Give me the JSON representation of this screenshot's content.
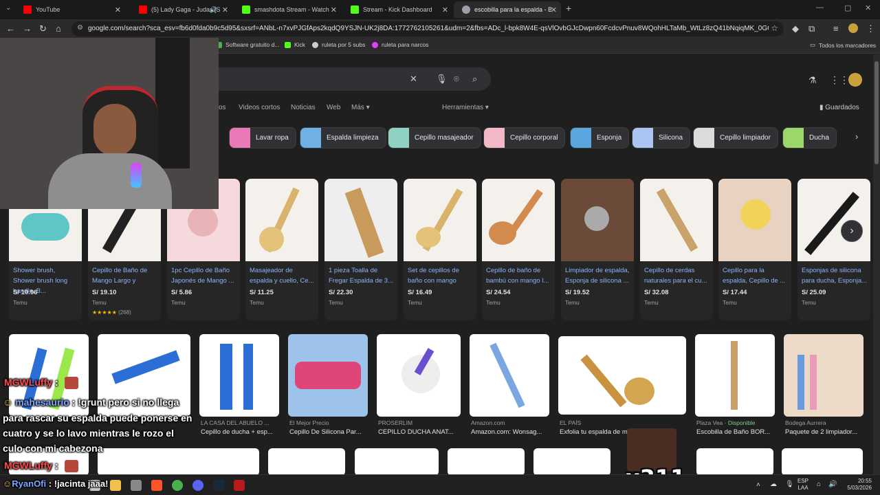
{
  "tabs": [
    {
      "label": "YouTube",
      "color": "#ff0000"
    },
    {
      "label": "(5) Lady Gaga - Judas [Suku",
      "color": "#ff0000"
    },
    {
      "label": "smashdota Stream - Watch Liv",
      "color": "#53fc18"
    },
    {
      "label": "Stream - Kick Dashboard",
      "color": "#53fc18"
    },
    {
      "label": "escobilla para la espalda - Busc",
      "color": "#9aa0a6"
    }
  ],
  "address": {
    "url": "google.com/search?sca_esv=fb6d0fda0b9c5d95&sxsrf=ANbL-n7xvPJGfAps2kqdQ9YSJN-UK2j8DA:1772762105261&udm=2&fbs=ADc_l-bpk8W4E-qsVlOvbGJcDwpn60FcdcvPnuv8WQohHLTaMb_WtLz8zQ41bNqiqMK_0GCDA2eBSrpJajL..."
  },
  "bookmarks": [
    {
      "label": "Software gratuito d...",
      "color": "#4caf50"
    },
    {
      "label": "Kick",
      "color": "#53fc18"
    },
    {
      "label": "ruleta por 5 subs",
      "color": "#cccccc"
    },
    {
      "label": "ruleta para narcos",
      "color": "#e040fb"
    }
  ],
  "bookmarks_all": "Todos los marcadores",
  "filters": {
    "partial": "os",
    "videos": "Videos cortos",
    "news": "Noticias",
    "web": "Web",
    "more": "Más",
    "tools": "Herramientas",
    "saved": "Guardados"
  },
  "chips": [
    {
      "label": "Lavar ropa",
      "color": "#e97ab8"
    },
    {
      "label": "Espalda limpieza",
      "color": "#6fb0e5"
    },
    {
      "label": "Cepillo masajeador",
      "color": "#8fd1c3"
    },
    {
      "label": "Cepillo corporal",
      "color": "#f2b8c6"
    },
    {
      "label": "Esponja",
      "color": "#5aa7e0"
    },
    {
      "label": "Silicona",
      "color": "#a9c6f2"
    },
    {
      "label": "Cepillo limpiador",
      "color": "#dcdcdc"
    },
    {
      "label": "Ducha",
      "color": "#9ad86b"
    }
  ],
  "products": [
    {
      "title": "Shower brush, Shower brush long handle, B...",
      "price": "S/ 10.96",
      "store": "Temu",
      "color": "#5ec6c6",
      "rating": ""
    },
    {
      "title": "Cepillo de Baño de Mango Largo y",
      "price": "S/ 19.10",
      "store": "Temu",
      "color": "#222222",
      "rating": "(268)"
    },
    {
      "title": "1pc Cepillo de Baño Japonés de Mango ...",
      "price": "S/ 5.86",
      "store": "Temu",
      "color": "#e8b4b8",
      "rating": ""
    },
    {
      "title": "Masajeador de espalda y cuello, Ce...",
      "price": "S/ 11.25",
      "store": "Temu",
      "color": "#d9b36b",
      "rating": ""
    },
    {
      "title": "1 pieza Toalla de Fregar Espalda de 3...",
      "price": "S/ 22.30",
      "store": "Temu",
      "color": "#c89b5c",
      "rating": ""
    },
    {
      "title": "Set de cepillos de baño con mango",
      "price": "S/ 16.49",
      "store": "Temu",
      "color": "#d9b36b",
      "rating": ""
    },
    {
      "title": "Cepillo de baño de bambú con mango l...",
      "price": "S/ 24.54",
      "store": "Temu",
      "color": "#d28a4e",
      "rating": ""
    },
    {
      "title": "Limpiador de espalda, Esponja de silicona ...",
      "price": "S/ 19.52",
      "store": "Temu",
      "color": "#6b4a3a",
      "rating": ""
    },
    {
      "title": "Cepillo de cerdas naturales para el cu...",
      "price": "S/ 32.08",
      "store": "Temu",
      "color": "#c9a36a",
      "rating": ""
    },
    {
      "title": "Cepillo para la espalda, Cepillo de ...",
      "price": "S/ 17.44",
      "store": "Temu",
      "color": "#f2d35a",
      "rating": ""
    },
    {
      "title": "Esponjas de silicona para ducha, Esponja...",
      "price": "S/ 25.09",
      "store": "Temu",
      "color": "#1a1a1a",
      "rating": ""
    }
  ],
  "results": [
    {
      "source": "LA CASA DEL ABUELO ...",
      "title": "Cepillo de ducha + esp...",
      "color": "#2b6fd6"
    },
    {
      "source": "El Mejor Precio",
      "title": "Cepillo De Silicona Par...",
      "color": "#e0457a"
    },
    {
      "source": "PROSERLIM",
      "title": "CEPILLO DUCHA ANAT...",
      "color": "#6a4fd0"
    },
    {
      "source": "Amazon.com",
      "title": "Amazon.com: Wonsag...",
      "color": "#7aa7e0"
    },
    {
      "source": "EL PAÍS",
      "title": "Exfolia tu espalda de m",
      "color": "#c8923e"
    },
    {
      "source": "Plaza Vea",
      "title": "Escobilla de Baño BOR...",
      "color": "#c9a06a",
      "badge": "Disponible"
    },
    {
      "source": "Bodega Aurrera",
      "title": "Paquete de 2 limpiador...",
      "color": "#6a9bdc"
    }
  ],
  "chat": [
    {
      "user": "MGWLuffy",
      "text": ""
    },
    {
      "user": "mahesaurio",
      "text": "!grunt pero si no llega"
    },
    {
      "user": "",
      "text": "para rascar su espalda puede ponerse en"
    },
    {
      "user": "",
      "text": "cuatro y se lo lavo mientras le rozo el"
    },
    {
      "user": "",
      "text": "culo con mi cabezona"
    },
    {
      "user": "MGWLuffy",
      "text": ""
    },
    {
      "user": "RyanOfi",
      "text": "!jacinta jaaa!"
    }
  ],
  "overlay_count": "x311",
  "tray": {
    "lang1": "ESP",
    "lang2": "LAA",
    "time": "20:55",
    "date": "5/03/2026"
  }
}
